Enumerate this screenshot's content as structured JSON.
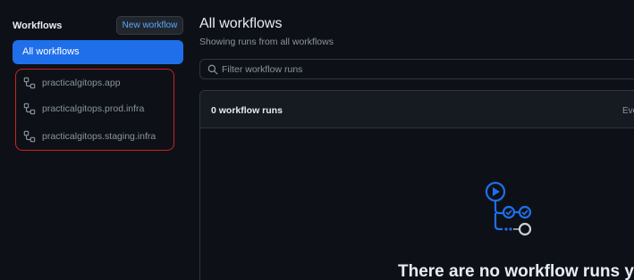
{
  "sidebar": {
    "title": "Workflows",
    "new_workflow_label": "New workflow",
    "all_workflows_label": "All workflows",
    "workflows": [
      {
        "label": "practicalgitops.app"
      },
      {
        "label": "practicalgitops.prod.infra"
      },
      {
        "label": "practicalgitops.staging.infra"
      }
    ]
  },
  "main": {
    "title": "All workflows",
    "subtitle": "Showing runs from all workflows",
    "filter_placeholder": "Filter workflow runs",
    "runs_count": "0 workflow runs",
    "event_filter_label": "Eve",
    "empty_message": "There are no workflow runs yet."
  },
  "colors": {
    "background": "#0d1117",
    "accent": "#1f6feb",
    "link": "#58a6ff",
    "highlight_border": "#d11f1f"
  },
  "icons": {
    "workflow_item": "workflow-icon",
    "filter": "search-icon",
    "empty_state": "actions-empty-illustration"
  }
}
